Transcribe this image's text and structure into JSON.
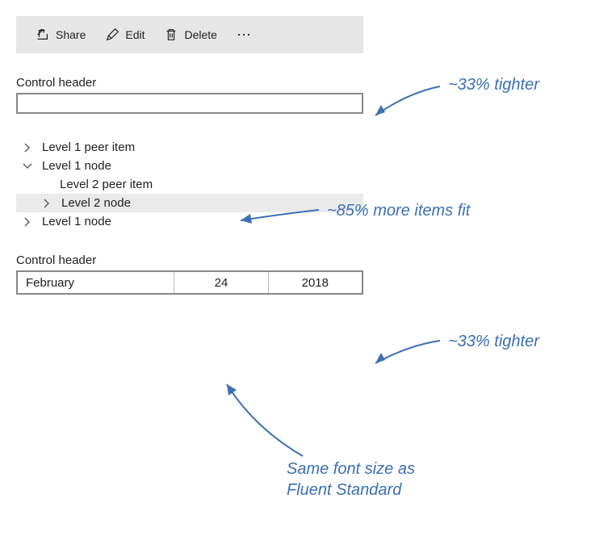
{
  "toolbar": {
    "share_label": "Share",
    "edit_label": "Edit",
    "delete_label": "Delete",
    "overflow": "⋯"
  },
  "control1": {
    "header": "Control header",
    "value": ""
  },
  "tree": {
    "items": [
      {
        "label": "Level 1 peer item",
        "expanded": false,
        "indent": 1
      },
      {
        "label": "Level 1 node",
        "expanded": true,
        "indent": 1
      },
      {
        "label": "Level 2 peer item",
        "expanded": null,
        "indent": 2
      },
      {
        "label": "Level 2 node",
        "expanded": false,
        "indent": 2,
        "selected": true
      },
      {
        "label": "Level 1 node",
        "expanded": false,
        "indent": 1
      }
    ]
  },
  "control2": {
    "header": "Control header",
    "month": "February",
    "day": "24",
    "year": "2018"
  },
  "annotations": {
    "a1": "~33% tighter",
    "a2": "~85% more items fit",
    "a3": "~33% tighter",
    "a4": "Same font size as Fluent Standard"
  }
}
